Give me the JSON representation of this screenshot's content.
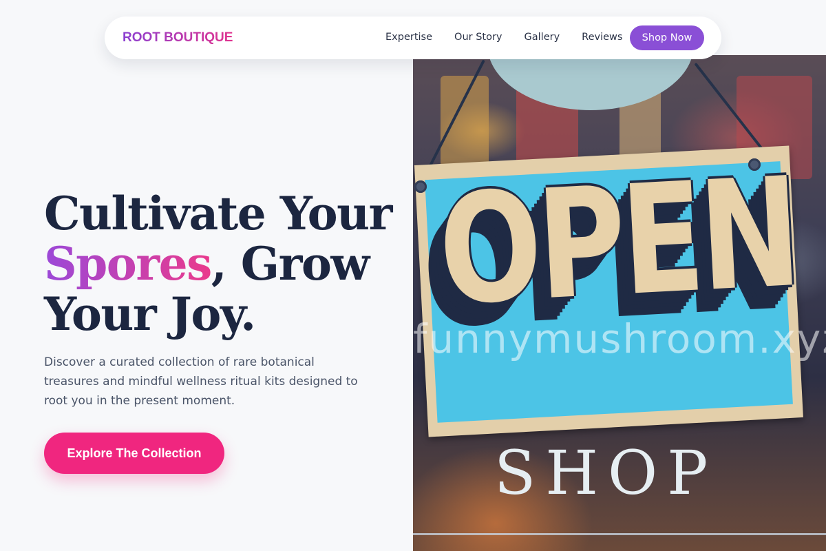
{
  "nav": {
    "brand": "ROOT BOUTIQUE",
    "links": [
      "Expertise",
      "Our Story",
      "Gallery",
      "Reviews"
    ],
    "cta_label": "Shop Now"
  },
  "hero": {
    "headline_part1": "Cultivate Your",
    "headline_accent": "Spores",
    "headline_part2": ", Grow Your Joy.",
    "subtext": "Discover a curated collection of rare botanical treasures and mindful wellness ritual kits designed to root you in the present moment.",
    "cta_label": "Explore The Collection"
  },
  "image": {
    "sign_text": "OPEN",
    "shop_text": "SHOP",
    "watermark": "funnymushroom.xyz"
  },
  "colors": {
    "background": "#f7f8fa",
    "heading": "#1c2640",
    "accent_purple": "#8a4fd6",
    "accent_pink": "#f0267f",
    "sign_blue": "#4cc4e6"
  }
}
